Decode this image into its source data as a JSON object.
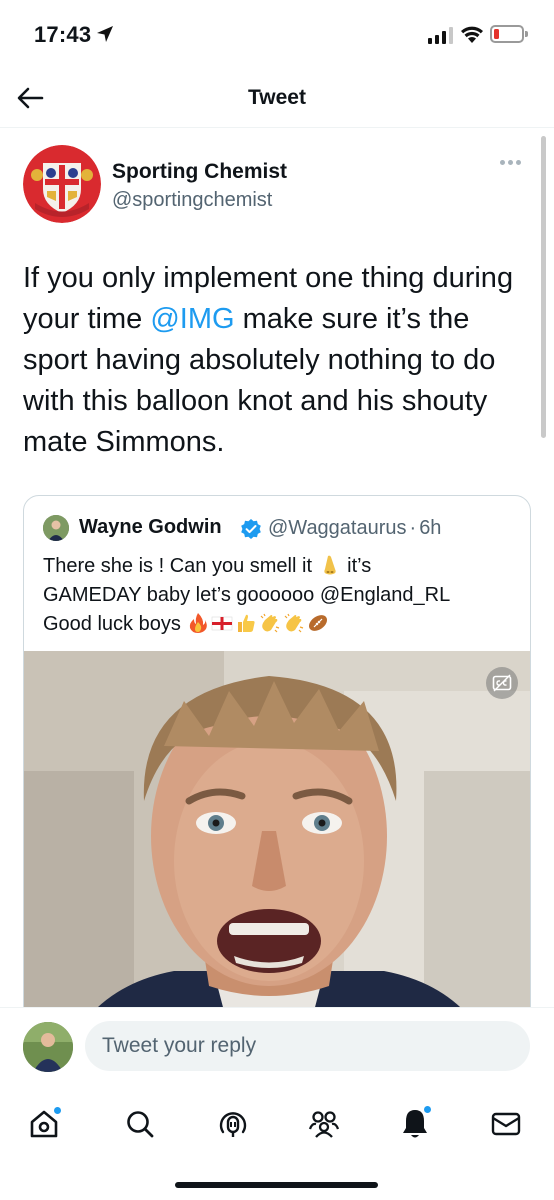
{
  "status_bar": {
    "time": "17:43",
    "icons": [
      "location-arrow-icon",
      "cellular-signal-icon",
      "wifi-icon",
      "battery-icon"
    ],
    "battery_color": "#e4332c"
  },
  "header": {
    "title": "Tweet",
    "back_icon": "arrow-left-icon"
  },
  "tweet": {
    "author_name": "Sporting Chemist",
    "author_handle": "@sportingchemist",
    "text_before": "If you only implement one thing during your time ",
    "mention": "@IMG",
    "text_after": " make sure it’s the sport having absolutely nothing to do with this balloon knot and his shouty mate Simmons."
  },
  "quoted_tweet": {
    "author_name": "Wayne Godwin",
    "verified": true,
    "handle": "@Waggataurus",
    "separator": "·",
    "time_ago": "6h",
    "text_line1_a": "There she is ! Can you smell it ",
    "text_line1_b": " it’s",
    "text_line2": "GAMEDAY baby let’s goooooo @England_RL",
    "text_line3": "Good luck boys ",
    "emojis_line1": [
      "nose-emoji"
    ],
    "emojis_line3": [
      "fire-emoji",
      "england-flag-emoji",
      "thumbs-up-emoji",
      "clapping-hands-emoji",
      "clapping-hands-emoji",
      "rugby-ball-emoji"
    ],
    "media_type": "video",
    "media_icon": "closed-captions-icon"
  },
  "reply_bar": {
    "placeholder": "Tweet your reply"
  },
  "bottom_nav": {
    "items": [
      {
        "name": "home",
        "icon": "home-icon",
        "has_badge": true
      },
      {
        "name": "search",
        "icon": "search-icon",
        "has_badge": false
      },
      {
        "name": "spaces",
        "icon": "spaces-icon",
        "has_badge": false
      },
      {
        "name": "communities",
        "icon": "communities-icon",
        "has_badge": false
      },
      {
        "name": "notifications",
        "icon": "bell-icon",
        "has_badge": true
      },
      {
        "name": "messages",
        "icon": "envelope-icon",
        "has_badge": false
      }
    ],
    "accent": "#1d9bf0"
  }
}
